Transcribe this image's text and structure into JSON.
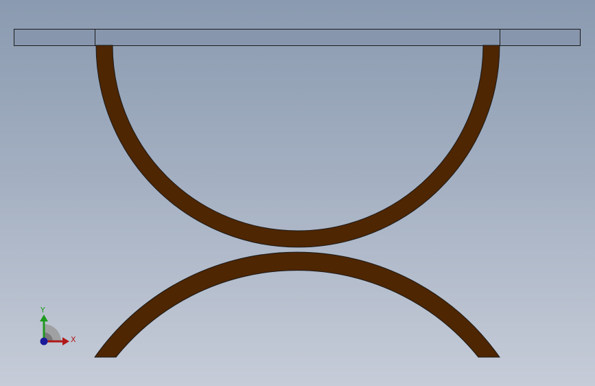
{
  "viewport": {
    "background_top": "#8a9ab0",
    "background_bottom": "#c6ccd8"
  },
  "model": {
    "tabletop_color": "#8796ad",
    "tabletop_edge_color": "#1a1a1a",
    "leg_color": "#4e2602",
    "leg_edge_color": "#1a1a1a",
    "parts": [
      "tabletop",
      "upper-arc-leg",
      "lower-arc-leg"
    ]
  },
  "triad": {
    "x_label": "X",
    "y_label": "Y",
    "x_color": "#b01818",
    "y_color": "#1e9a1e",
    "z_color": "#1a1a9a"
  }
}
